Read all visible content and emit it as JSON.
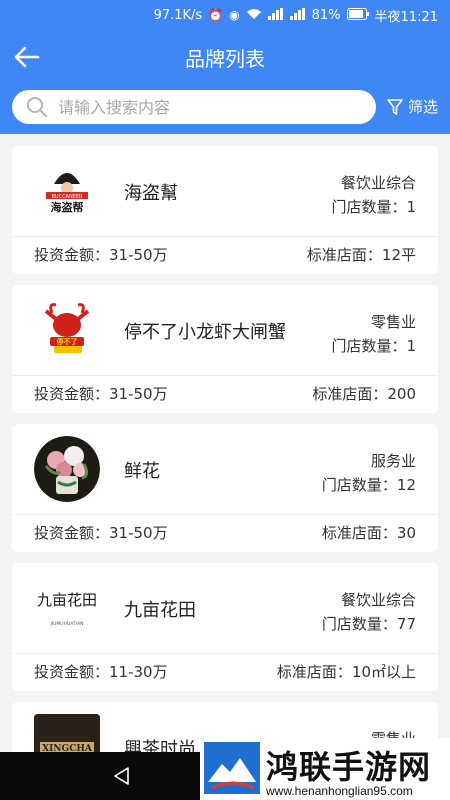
{
  "status_bar": {
    "speed": "97.1K/s",
    "battery": "81%",
    "time": "半夜11:21"
  },
  "header": {
    "title": "品牌列表"
  },
  "search": {
    "placeholder": "请输入搜索内容",
    "filter_label": "筛选"
  },
  "brands": [
    {
      "name": "海盗幫",
      "category": "餐饮业综合",
      "stores": "门店数量：1",
      "invest": "投资金额：31-50万",
      "area": "标准店面：12平",
      "logo_text": "海盗帮",
      "logo_sub": "BUCCANEER"
    },
    {
      "name": "停不了小龙虾大闸蟹",
      "category": "零售业",
      "stores": "门店数量：1",
      "invest": "投资金额：31-50万",
      "area": "标准店面：200",
      "logo_text": "停不了",
      "logo_sub": ""
    },
    {
      "name": "鲜花",
      "category": "服务业",
      "stores": "门店数量：12",
      "invest": "投资金额：31-50万",
      "area": "标准店面：30",
      "logo_text": "",
      "logo_sub": ""
    },
    {
      "name": "九亩花田",
      "category": "餐饮业综合",
      "stores": "门店数量：77",
      "invest": "投资金额：11-30万",
      "area": "标准店面：10㎡以上",
      "logo_text": "九亩花田",
      "logo_sub": "JIUMUHUATIAN"
    },
    {
      "name": "興茶时尚",
      "category": "零售业",
      "stores": "",
      "invest": "",
      "area": "",
      "logo_text": "XINGCHA",
      "logo_sub": ""
    }
  ],
  "watermark": {
    "text": "鸿联手游网",
    "url": "www.henanhonglian95.com"
  }
}
